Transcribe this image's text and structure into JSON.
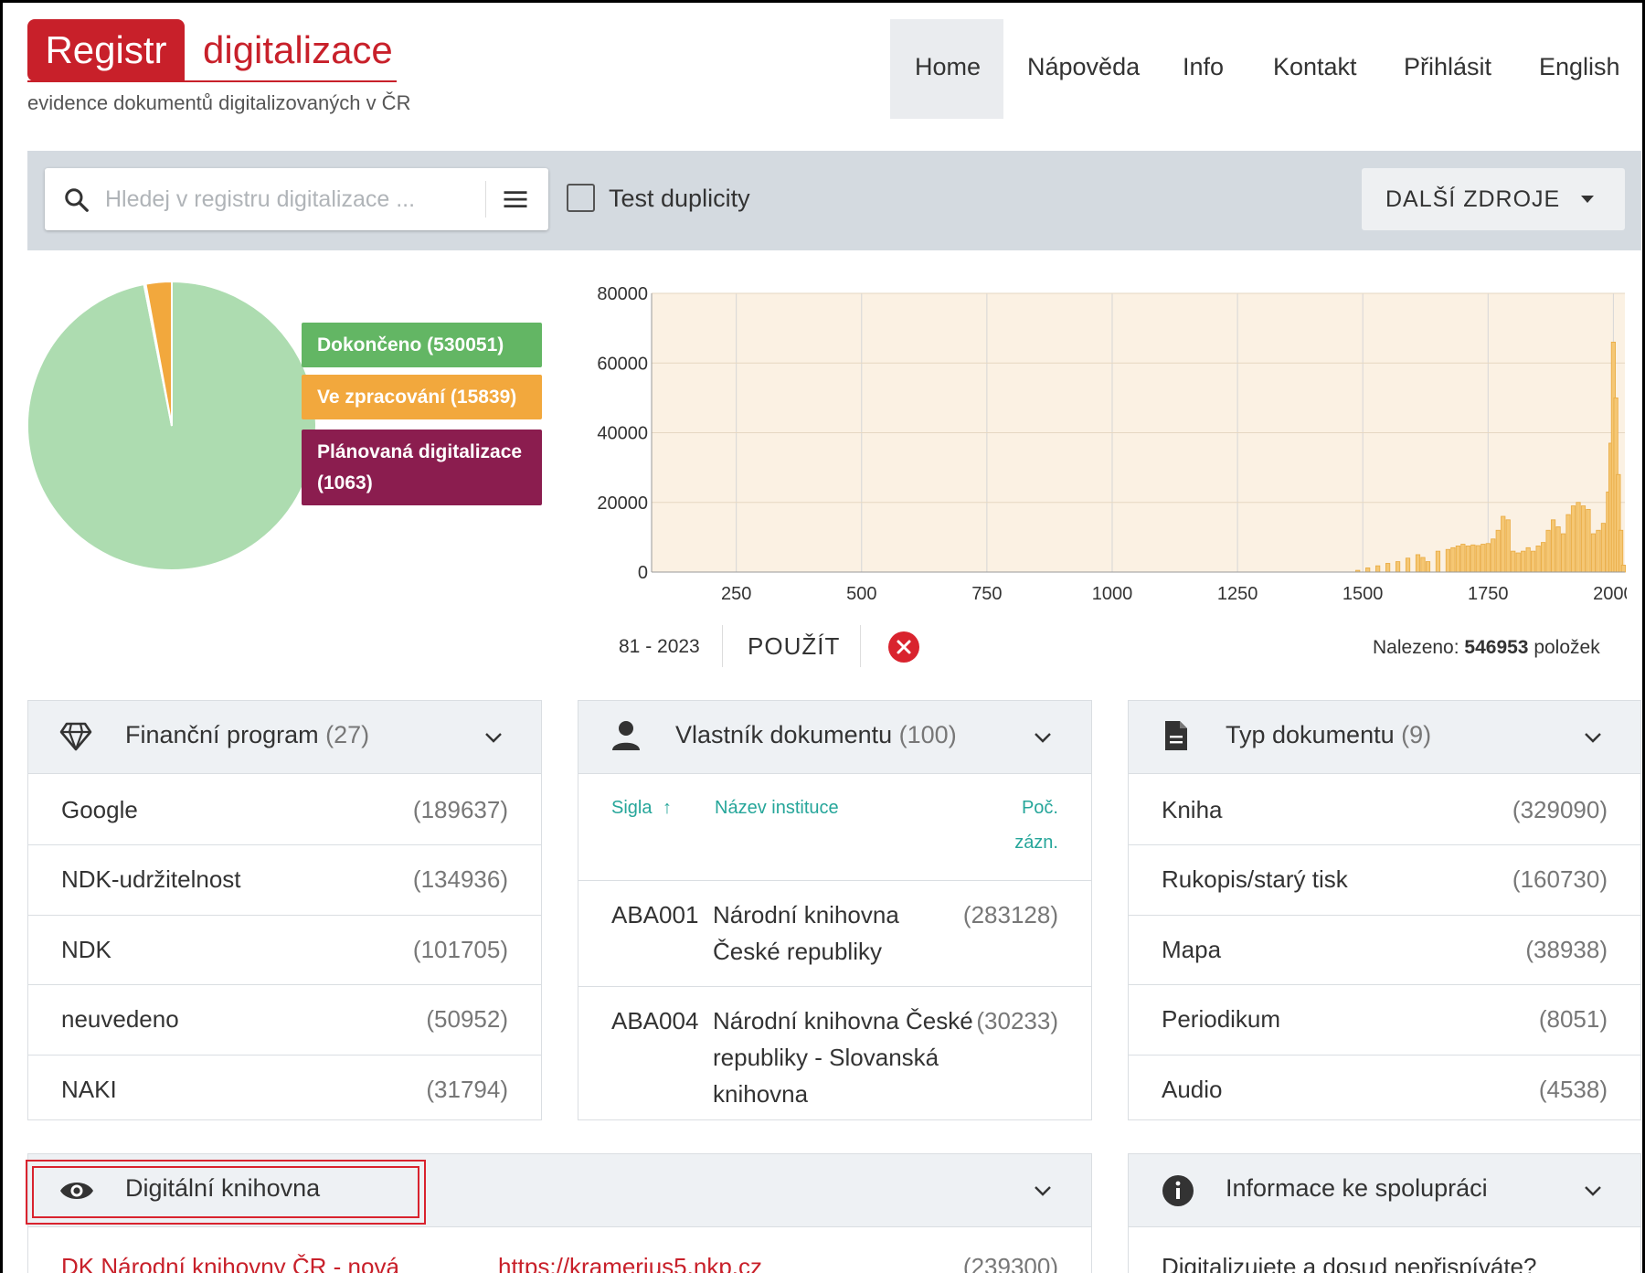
{
  "header": {
    "logo_box": "Registr",
    "logo_word": "digitalizace",
    "subtitle": "evidence dokumentů digitalizovaných v ČR",
    "nav": [
      "Home",
      "Nápověda",
      "Info",
      "Kontakt",
      "Přihlásit",
      "English"
    ],
    "nav_active": "Home"
  },
  "search": {
    "placeholder": "Hledej v registru digitalizace ...",
    "test_duplicity_label": "Test duplicity",
    "test_duplicity_checked": false,
    "dalsi_zdroje": "DALŠÍ ZDROJE"
  },
  "status_legend": [
    {
      "label": "Dokončeno (530051)",
      "color": "#63b664"
    },
    {
      "label": "Ve zpracování (15839)",
      "color": "#f2a83d"
    },
    {
      "label": "Plánovaná digitalizace (1063)",
      "color": "#8b1d4f"
    }
  ],
  "range": {
    "value": "81 - 2023",
    "apply_label": "POUŽÍT",
    "found_prefix": "Nalezeno:",
    "found_count": "546953",
    "found_suffix": "položek"
  },
  "chart_data": [
    {
      "type": "pie",
      "categories": [
        "Dokončeno",
        "Ve zpracování",
        "Plánovaná digitalizace"
      ],
      "values": [
        530051,
        15839,
        1063
      ],
      "colors": [
        "#addcb0",
        "#f2a83d",
        "#8b1d4f"
      ]
    },
    {
      "type": "bar",
      "title": "",
      "xlabel": "",
      "ylabel": "",
      "xlim": [
        81,
        2023
      ],
      "ylim": [
        0,
        80000
      ],
      "xticks": [
        250,
        500,
        750,
        1000,
        1250,
        1500,
        1750,
        2000
      ],
      "yticks": [
        0,
        20000,
        40000,
        60000,
        80000
      ],
      "bar_color": "#f5c774",
      "x": [
        1490,
        1510,
        1530,
        1550,
        1570,
        1590,
        1610,
        1620,
        1630,
        1650,
        1670,
        1680,
        1690,
        1700,
        1710,
        1720,
        1730,
        1740,
        1750,
        1760,
        1770,
        1780,
        1790,
        1800,
        1810,
        1820,
        1830,
        1840,
        1850,
        1860,
        1870,
        1880,
        1890,
        1900,
        1910,
        1920,
        1930,
        1940,
        1950,
        1960,
        1970,
        1980,
        1990,
        1995,
        2000,
        2005,
        2010,
        2015,
        2020
      ],
      "values": [
        500,
        1200,
        1800,
        2500,
        3000,
        4000,
        5000,
        4200,
        3000,
        6000,
        6500,
        7000,
        7500,
        8000,
        7500,
        7800,
        7600,
        8000,
        8200,
        9500,
        12000,
        16000,
        15000,
        6000,
        5500,
        6000,
        7000,
        6000,
        7500,
        8500,
        12000,
        15000,
        13000,
        11000,
        16500,
        19000,
        20000,
        19000,
        18000,
        11000,
        12000,
        14000,
        23000,
        37000,
        66000,
        50000,
        28000,
        12000,
        2000
      ]
    }
  ],
  "panels": {
    "financni": {
      "title": "Finanční program",
      "count": "(27)",
      "rows": [
        {
          "label": "Google",
          "count": "(189637)"
        },
        {
          "label": "NDK-udržitelnost",
          "count": "(134936)"
        },
        {
          "label": "NDK",
          "count": "(101705)"
        },
        {
          "label": "neuvedeno",
          "count": "(50952)"
        },
        {
          "label": "NAKI",
          "count": "(31794)"
        }
      ]
    },
    "vlastnik": {
      "title": "Vlastník dokumentu",
      "count": "(100)",
      "col_sigla": "Sigla",
      "col_nazev": "Název instituce",
      "col_poc": "Poč.",
      "col_poc2": "zázn.",
      "rows": [
        {
          "sigla": "ABA001",
          "line1": "Národní knihovna",
          "line2": "České republiky",
          "line3": "",
          "count": "(283128)"
        },
        {
          "sigla": "ABA004",
          "line1": "Národní knihovna České",
          "line2": "republiky - Slovanská",
          "line3": "knihovna",
          "count": "(30233)"
        }
      ]
    },
    "typ": {
      "title": "Typ dokumentu",
      "count": "(9)",
      "rows": [
        {
          "label": "Kniha",
          "count": "(329090)"
        },
        {
          "label": "Rukopis/starý tisk",
          "count": "(160730)"
        },
        {
          "label": "Mapa",
          "count": "(38938)"
        },
        {
          "label": "Periodikum",
          "count": "(8051)"
        },
        {
          "label": "Audio",
          "count": "(4538)"
        }
      ]
    },
    "digitalni": {
      "title": "Digitální knihovna",
      "row": {
        "name": "DK Národní knihovny ČR - nová",
        "url": "https://kramerius5.nkp.cz",
        "count": "(239300)"
      }
    },
    "informace": {
      "title": "Informace ke spolupráci",
      "text": "Digitalizujete a dosud nepřispíváte?"
    }
  },
  "colors": {
    "brand_red": "#c8202a",
    "teal": "#26a69a",
    "band_gray": "#d4dae0",
    "highlight_red": "#d9232e"
  }
}
